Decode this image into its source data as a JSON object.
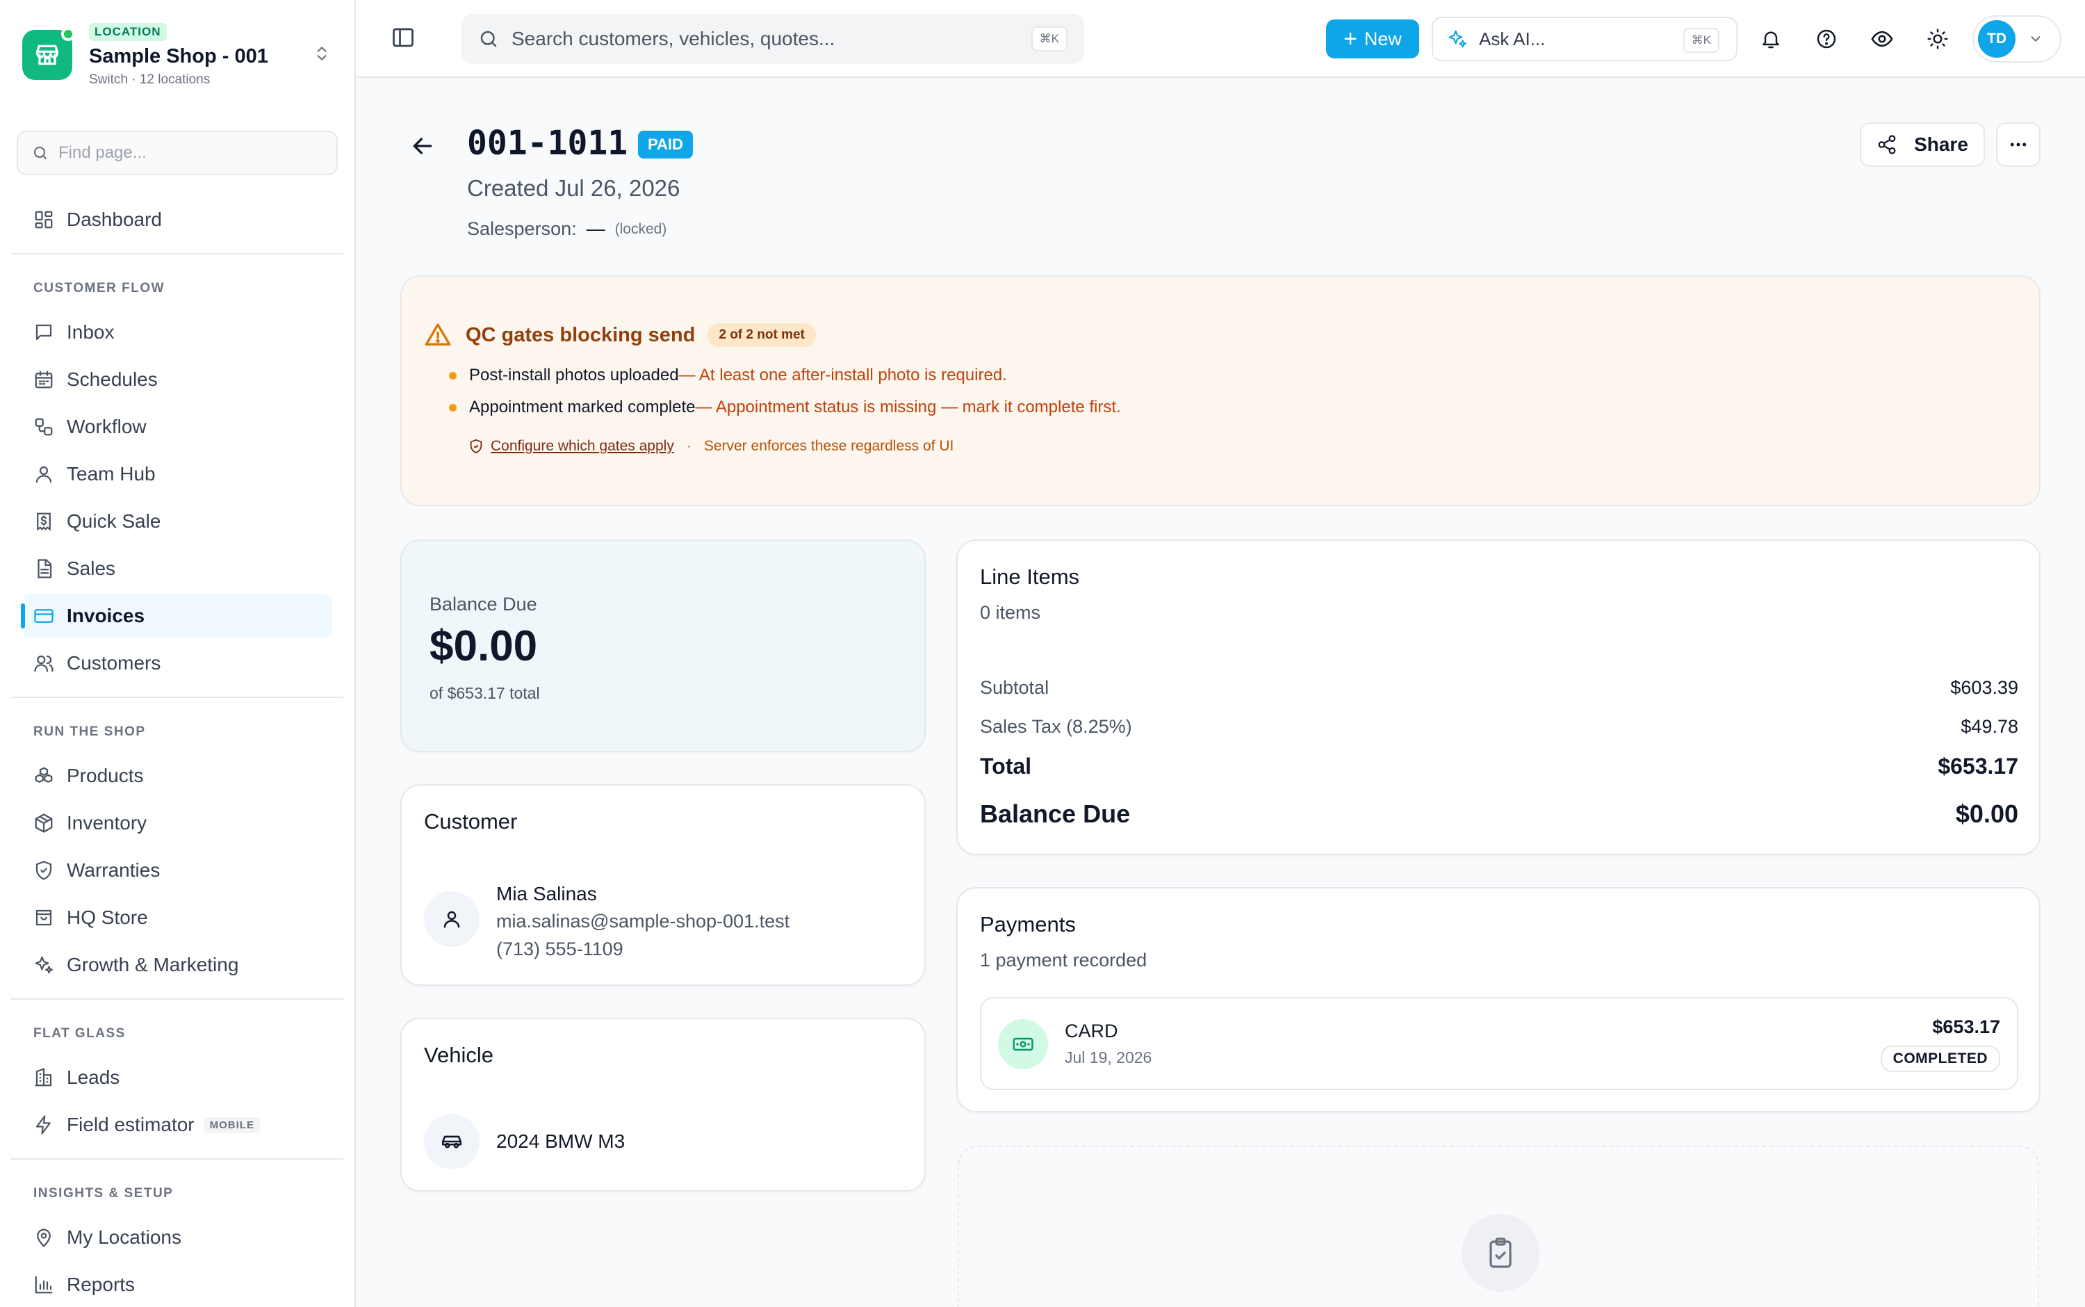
{
  "location": {
    "tag": "LOCATION",
    "name": "Sample Shop - 001",
    "sub": "Switch · 12 locations"
  },
  "sidebar": {
    "find_placeholder": "Find page...",
    "dashboard": "Dashboard",
    "sections": [
      {
        "label": "CUSTOMER FLOW",
        "items": [
          {
            "label": "Inbox",
            "icon": "message-square-icon"
          },
          {
            "label": "Schedules",
            "icon": "calendar-icon"
          },
          {
            "label": "Workflow",
            "icon": "workflow-icon"
          },
          {
            "label": "Team Hub",
            "icon": "user-icon"
          },
          {
            "label": "Quick Sale",
            "icon": "receipt-dollar-icon"
          },
          {
            "label": "Sales",
            "icon": "file-text-icon"
          },
          {
            "label": "Invoices",
            "icon": "credit-card-icon",
            "active": true
          },
          {
            "label": "Customers",
            "icon": "users-icon"
          }
        ]
      },
      {
        "label": "RUN THE SHOP",
        "items": [
          {
            "label": "Products",
            "icon": "boxes-icon"
          },
          {
            "label": "Inventory",
            "icon": "package-icon"
          },
          {
            "label": "Warranties",
            "icon": "shield-check-icon"
          },
          {
            "label": "HQ Store",
            "icon": "shopping-bag-icon"
          },
          {
            "label": "Growth & Marketing",
            "icon": "sparkles-icon"
          }
        ]
      },
      {
        "label": "FLAT GLASS",
        "items": [
          {
            "label": "Leads",
            "icon": "building-icon"
          },
          {
            "label": "Field estimator",
            "icon": "zap-icon",
            "badge": "MOBILE"
          }
        ]
      },
      {
        "label": "INSIGHTS & SETUP",
        "items": [
          {
            "label": "My Locations",
            "icon": "map-pin-icon"
          },
          {
            "label": "Reports",
            "icon": "bar-chart-icon"
          }
        ]
      }
    ]
  },
  "topbar": {
    "search_placeholder": "Search customers, vehicles, quotes...",
    "search_kbd": "⌘K",
    "new_label": "New",
    "ask_ai_label": "Ask AI...",
    "ask_ai_kbd": "⌘K",
    "avatar_initials": "TD"
  },
  "invoice": {
    "number": "001-1011",
    "status": "PAID",
    "created": "Created Jul 26, 2026",
    "salesperson_label": "Salesperson:",
    "salesperson_value": "—",
    "salesperson_note": "(locked)",
    "share_label": "Share"
  },
  "qc": {
    "title": "QC gates blocking send",
    "count": "2 of 2 not met",
    "items": [
      {
        "name": "Post-install photos uploaded",
        "desc": " — At least one after-install photo is required."
      },
      {
        "name": "Appointment marked complete",
        "desc": " — Appointment status is missing — mark it complete first."
      }
    ],
    "configure_link": "Configure which gates apply",
    "separator": "·",
    "server_note": "Server enforces these regardless of UI"
  },
  "balance": {
    "label": "Balance Due",
    "amount": "$0.00",
    "of_total": "of $653.17 total"
  },
  "customer": {
    "title": "Customer",
    "name": "Mia Salinas",
    "email": "mia.salinas@sample-shop-001.test",
    "phone": "(713) 555-1109"
  },
  "vehicle": {
    "title": "Vehicle",
    "name": "2024 BMW M3"
  },
  "line_items": {
    "title": "Line Items",
    "count": "0 items",
    "subtotal_label": "Subtotal",
    "subtotal": "$603.39",
    "tax_label": "Sales Tax (8.25%)",
    "tax": "$49.78",
    "total_label": "Total",
    "total": "$653.17",
    "balance_label": "Balance Due",
    "balance": "$0.00"
  },
  "payments": {
    "title": "Payments",
    "count": "1 payment recorded",
    "items": [
      {
        "method": "CARD",
        "date": "Jul 19, 2026",
        "amount": "$653.17",
        "status": "COMPLETED"
      }
    ]
  },
  "colors": {
    "accent": "#0ea5e9",
    "brand_green": "#10b981",
    "warning": "#f59e0b"
  }
}
